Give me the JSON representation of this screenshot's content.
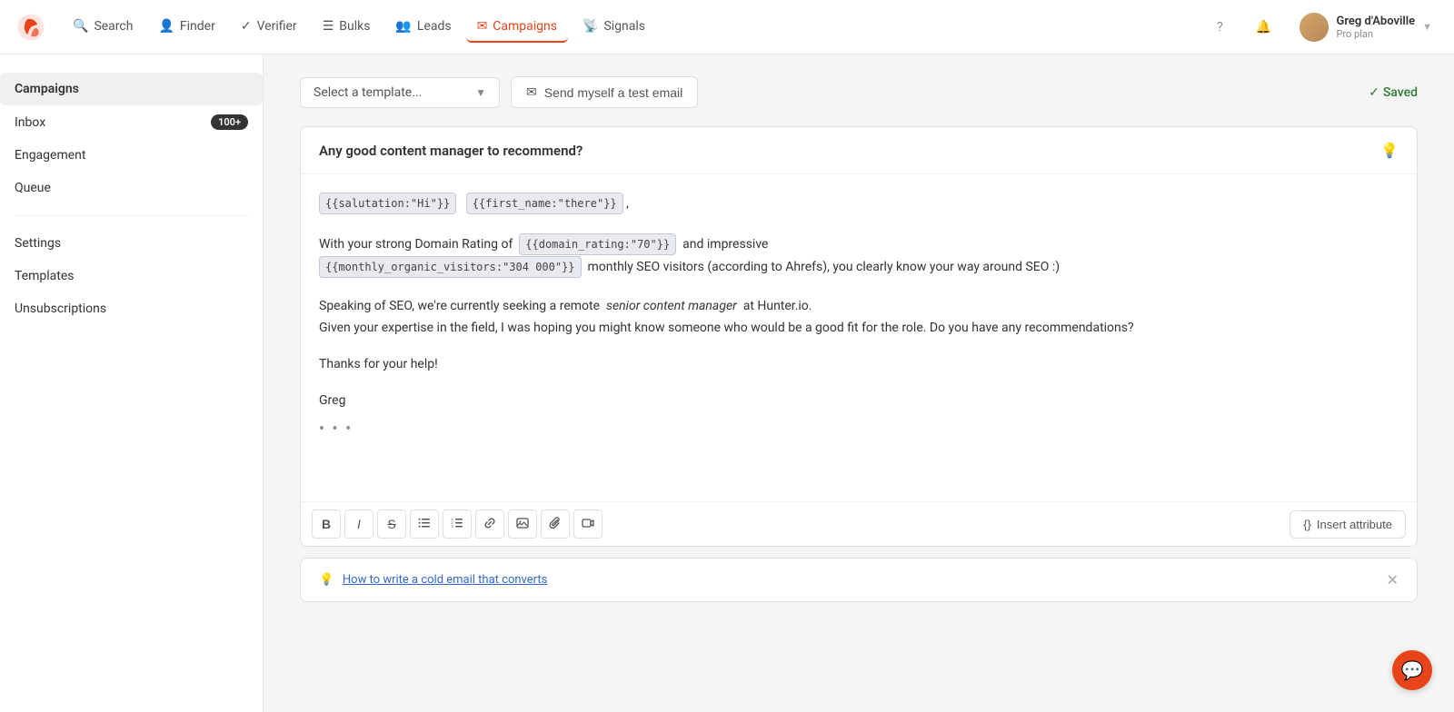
{
  "nav": {
    "logo_label": "Hunter",
    "items": [
      {
        "label": "Search",
        "icon": "search",
        "active": false
      },
      {
        "label": "Finder",
        "icon": "finder",
        "active": false
      },
      {
        "label": "Verifier",
        "icon": "verifier",
        "active": false
      },
      {
        "label": "Bulks",
        "icon": "bulks",
        "active": false
      },
      {
        "label": "Leads",
        "icon": "leads",
        "active": false
      },
      {
        "label": "Campaigns",
        "icon": "campaigns",
        "active": true
      },
      {
        "label": "Signals",
        "icon": "signals",
        "active": false
      }
    ],
    "help_label": "?",
    "user": {
      "name": "Greg d'Aboville",
      "plan": "Pro plan"
    }
  },
  "sidebar": {
    "title": "Campaigns",
    "items": [
      {
        "label": "Campaigns",
        "active": true,
        "badge": null
      },
      {
        "label": "Inbox",
        "active": false,
        "badge": "100+"
      },
      {
        "label": "Engagement",
        "active": false,
        "badge": null
      },
      {
        "label": "Queue",
        "active": false,
        "badge": null
      }
    ],
    "secondary_items": [
      {
        "label": "Settings",
        "active": false
      },
      {
        "label": "Templates",
        "active": false
      },
      {
        "label": "Unsubscriptions",
        "active": false
      }
    ]
  },
  "toolbar": {
    "template_placeholder": "Select a template...",
    "test_email_label": "Send myself a test email",
    "saved_label": "Saved"
  },
  "email": {
    "subject": "Any good content manager to recommend?",
    "body_lines": [
      "{{salutation:\"Hi\"}}",
      "{{first_name:\"there\"}}",
      ","
    ],
    "para1_prefix": "With your strong Domain Rating of",
    "domain_rating_attr": "{{domain_rating:\"70\"}}",
    "para1_middle": "and impressive",
    "monthly_visitors_attr": "{{monthly_organic_visitors:\"304 000\"}}",
    "para1_suffix": "monthly SEO visitors (according to Ahrefs), you clearly know your way around SEO :)",
    "para2_line1": "Speaking of SEO, we're currently seeking a remote",
    "para2_italic": "senior content manager",
    "para2_line1_end": "at Hunter.io.",
    "para2_line2": "Given your expertise in the field, I was hoping you might know someone who would be a good fit for the role. Do you have any recommendations?",
    "sign_off": "Thanks for your help!",
    "signature": "Greg",
    "dots": "• • •"
  },
  "format_toolbar": {
    "bold": "B",
    "italic": "I",
    "strikethrough": "S",
    "bullet_list": "≡",
    "numbered_list": "⒈",
    "link": "🔗",
    "image": "🖼",
    "attachment": "📎",
    "video": "▶",
    "insert_attr_label": "Insert attribute",
    "insert_attr_icon": "{}"
  },
  "tip": {
    "label": "How to write a cold email that converts"
  }
}
